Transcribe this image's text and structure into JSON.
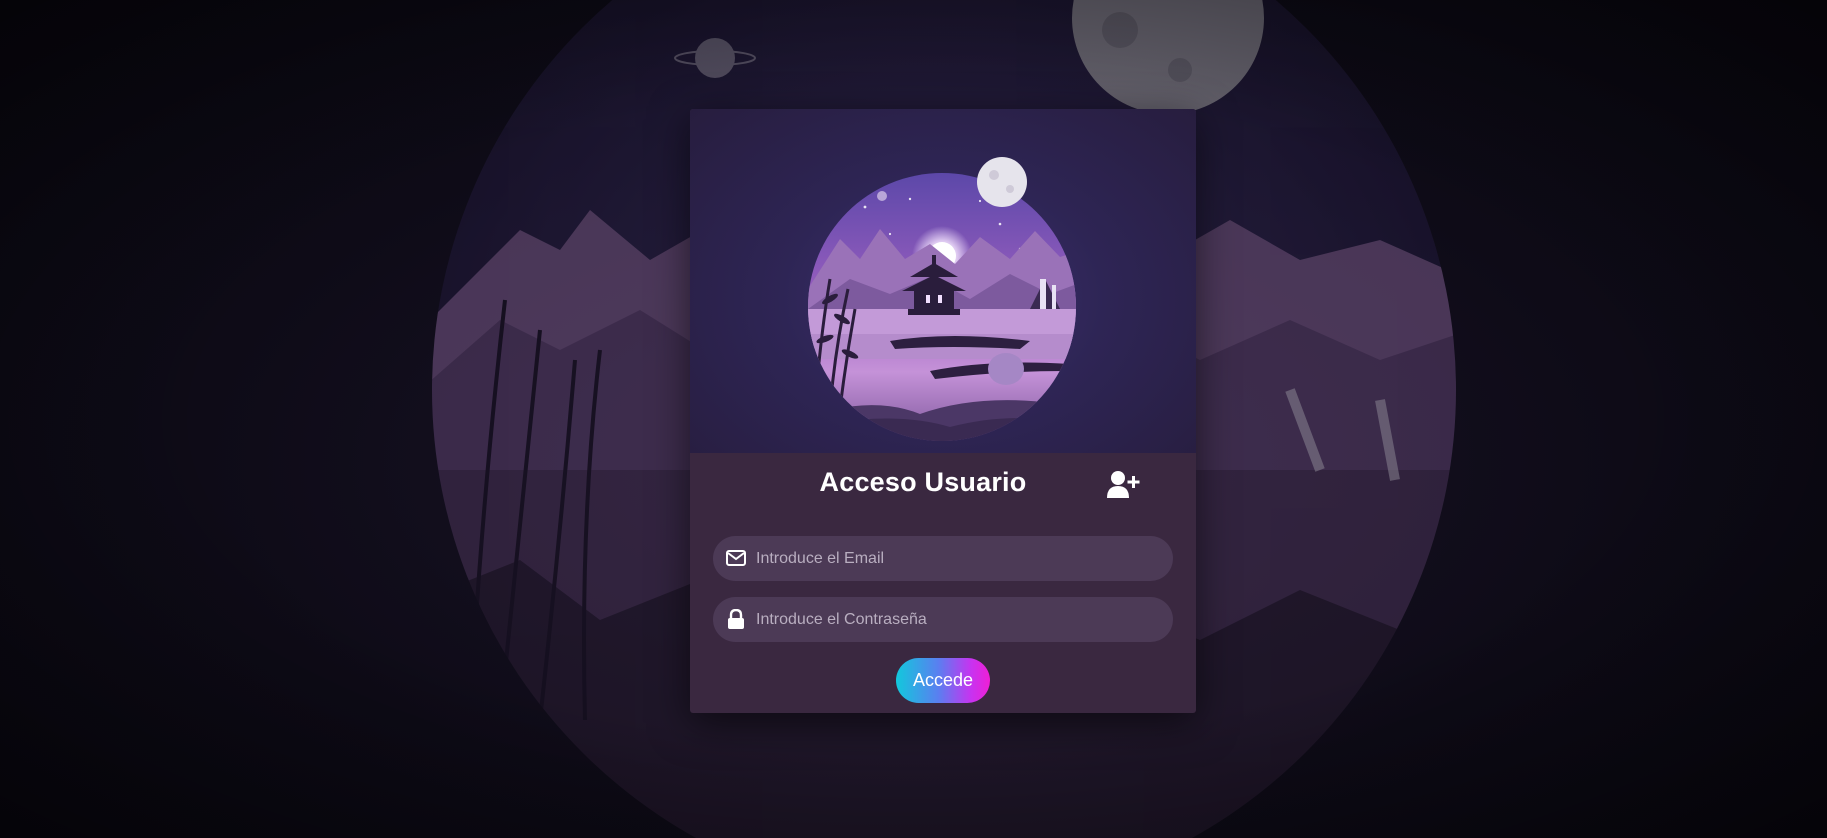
{
  "login": {
    "title": "Acceso Usuario",
    "email_placeholder": "Introduce el Email",
    "password_placeholder": "Introduce el Contraseña",
    "submit_label": "Accede"
  },
  "icons": {
    "register": "user-plus-icon",
    "email": "envelope-icon",
    "password": "lock-icon"
  },
  "colors": {
    "background": "#0d0b16",
    "card": "#3a2840",
    "field": "#4c3a56",
    "button_gradient_start": "#12c8dc",
    "button_gradient_end": "#ef1fd5"
  }
}
